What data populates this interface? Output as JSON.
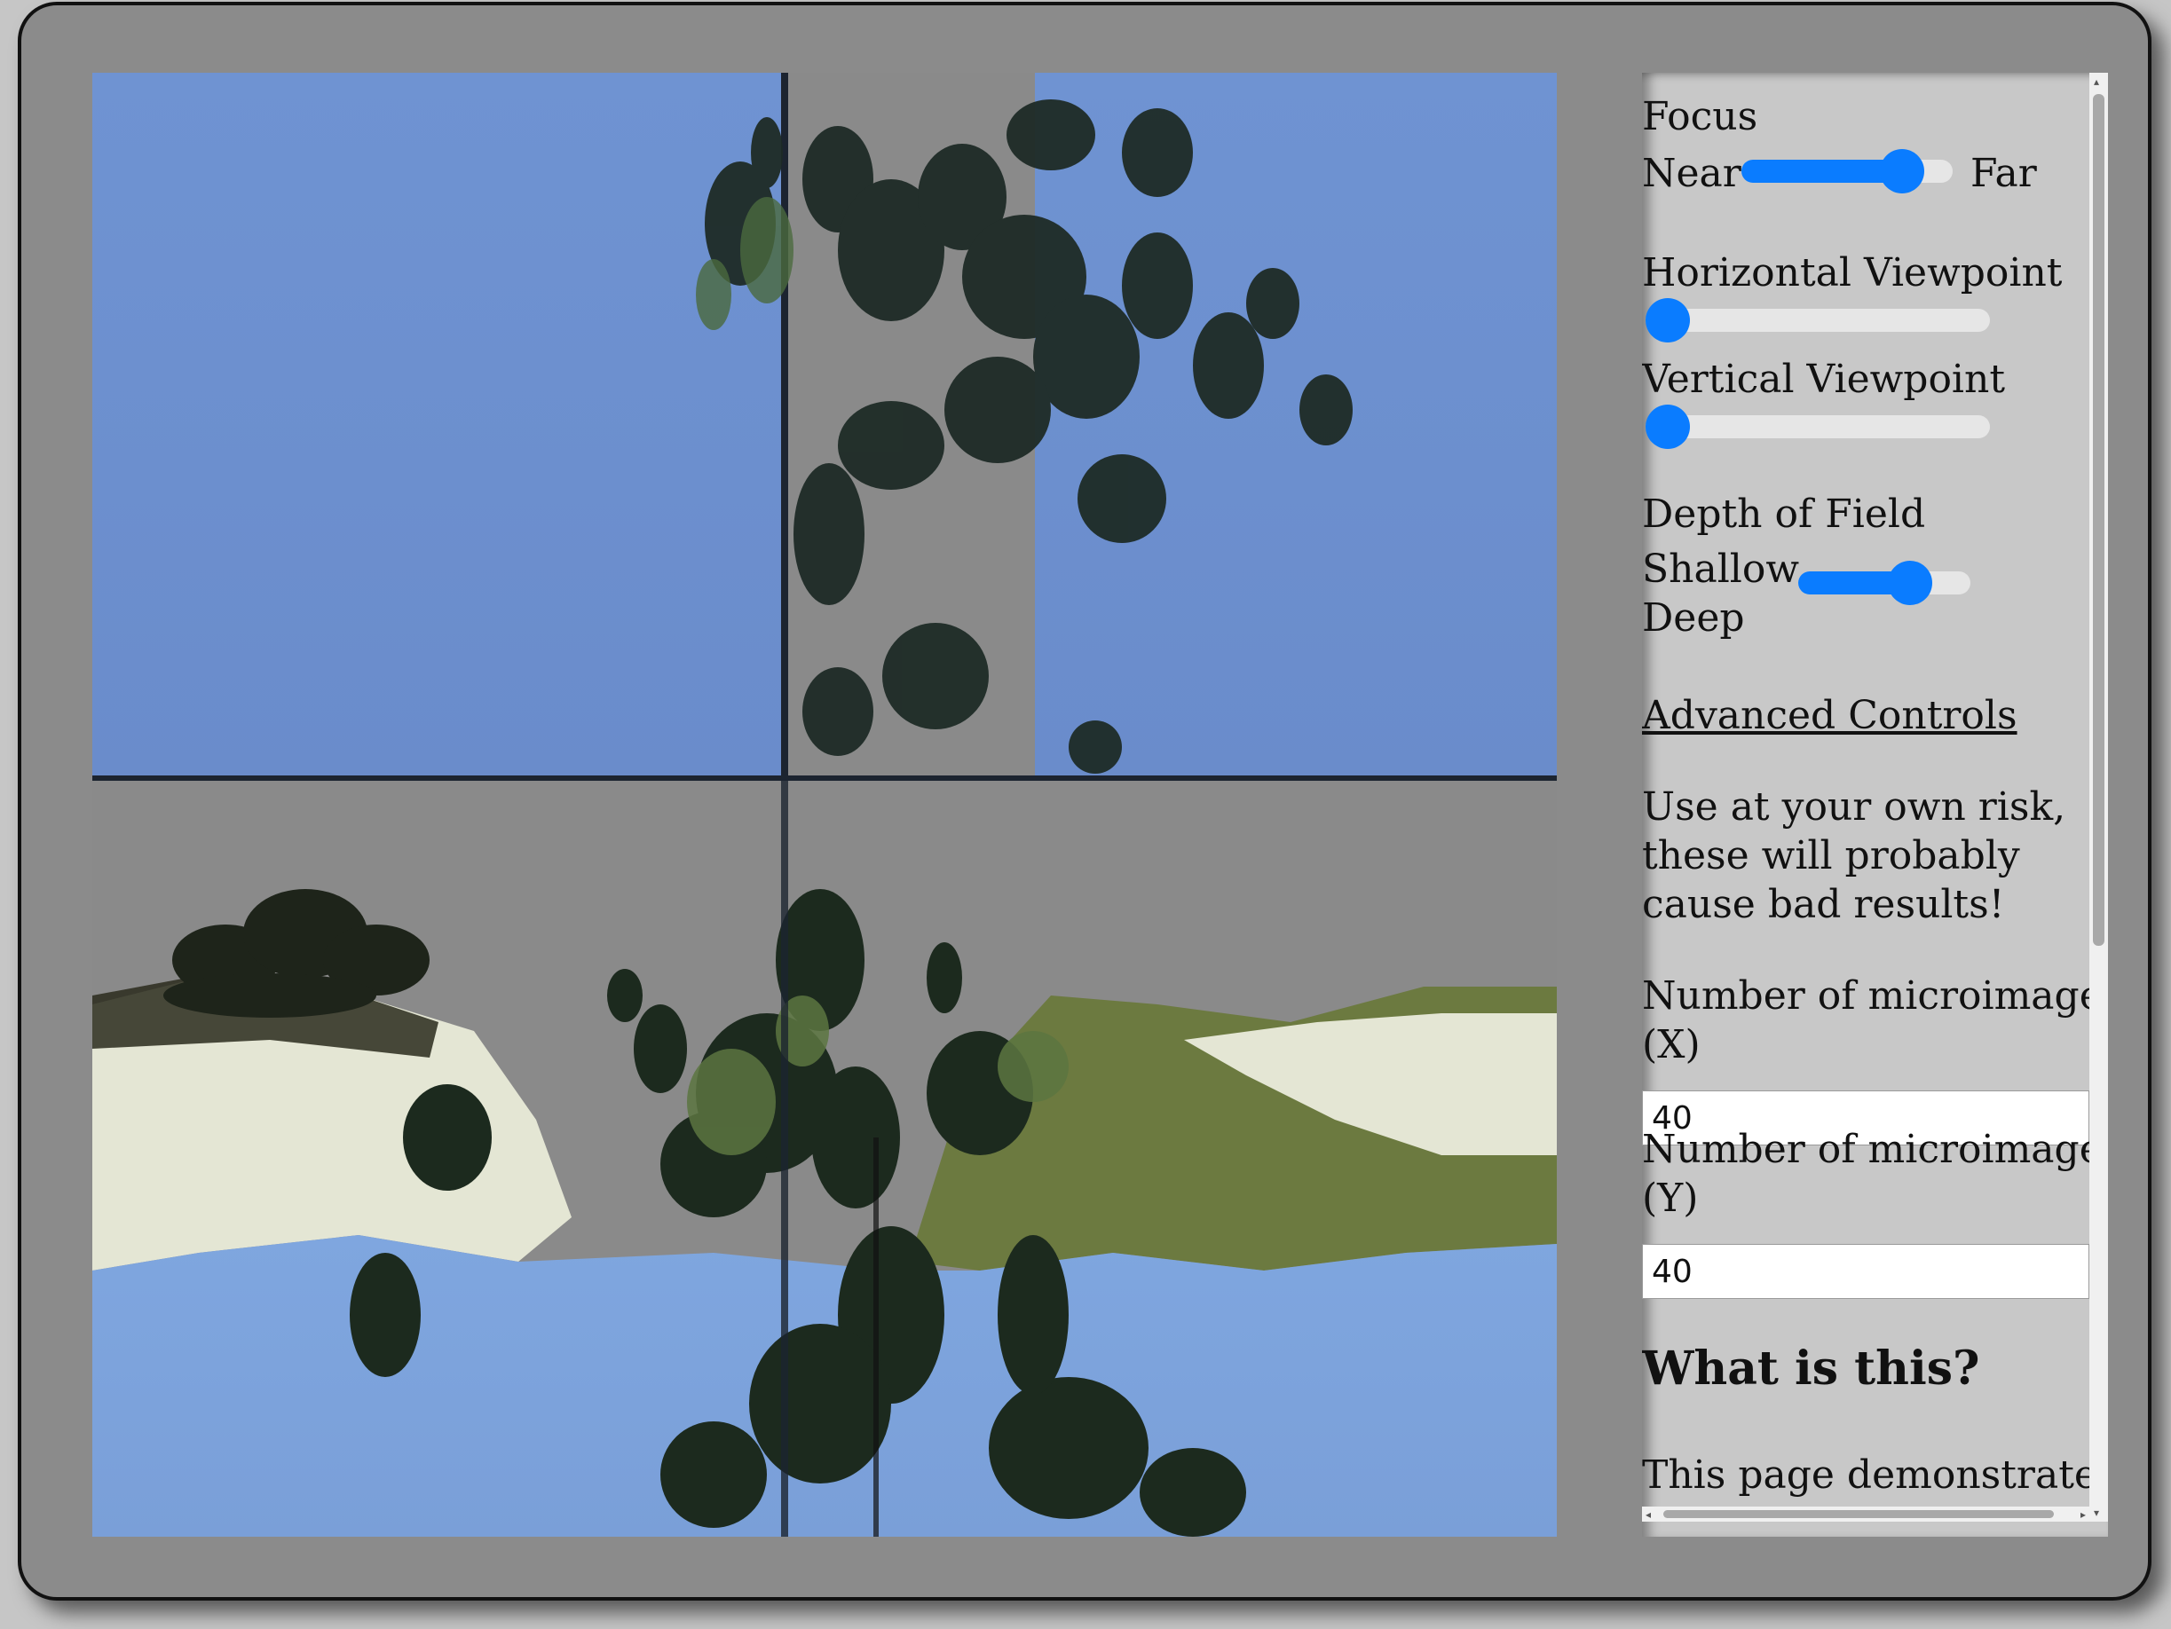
{
  "controls": {
    "focus": {
      "title": "Focus",
      "min_label": "Near",
      "max_label": "Far",
      "value_fraction": 0.83
    },
    "horizontal_viewpoint": {
      "title": "Horizontal Viewpoint",
      "value_fraction": 0.0
    },
    "vertical_viewpoint": {
      "title": "Vertical Viewpoint",
      "value_fraction": 0.0
    },
    "depth_of_field": {
      "title": "Depth of Field",
      "min_label": "Shallow",
      "max_label": "Deep",
      "value_fraction": 0.7
    }
  },
  "advanced": {
    "link_label": "Advanced Controls",
    "warning_line1": "Use at your own risk,",
    "warning_line2": "these will probably",
    "warning_line3": "cause bad results!",
    "micro_x_label_line1": "Number of microimages",
    "micro_x_label_line2": "(X)",
    "micro_x_value": "40",
    "micro_y_label_line1": "Number of microimages",
    "micro_y_label_line2": "(Y)",
    "micro_y_value": "40"
  },
  "about": {
    "heading": "What is this?",
    "intro": "This page demonstrates"
  },
  "colors": {
    "frame_bg": "#8b8b8b",
    "panel_bg": "#c8c8c8",
    "slider_accent": "#0a7cff",
    "sky": "#7196d4",
    "foliage": "#1f2e20",
    "ground": "#e3e6d2",
    "grass": "#6e7d3e"
  }
}
